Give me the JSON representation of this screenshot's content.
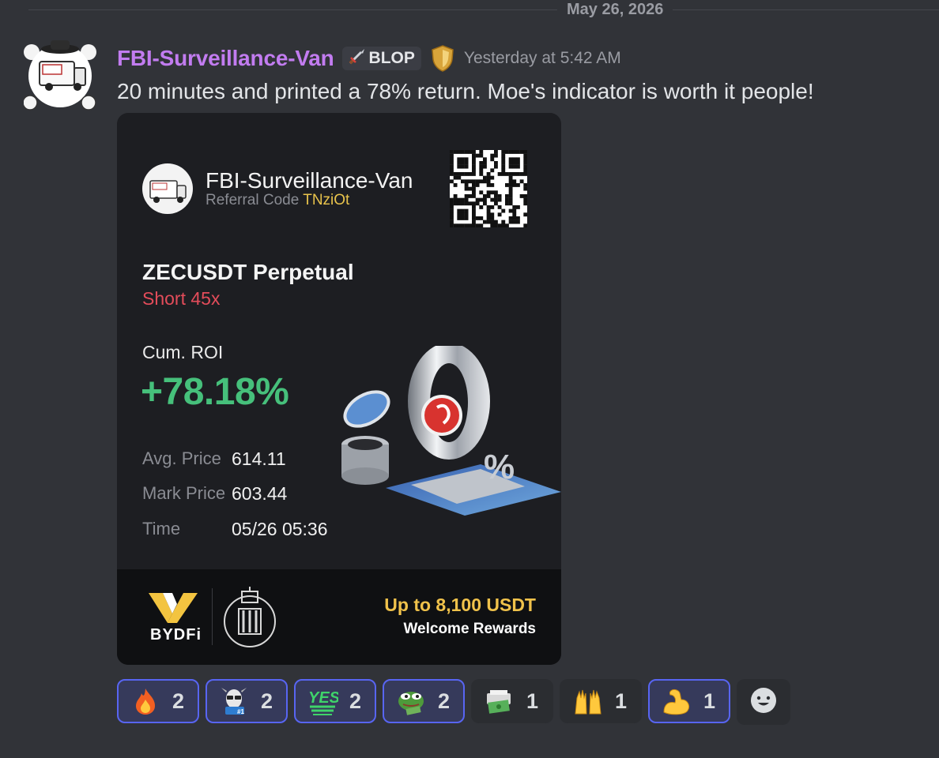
{
  "date_divider": "May 26, 2026",
  "author": {
    "name": "FBI-Surveillance-Van",
    "tag": "BLOP",
    "timestamp": "Yesterday at 5:42 AM"
  },
  "message_text": "20 minutes and printed a 78% return. Moe's indicator is worth it people!",
  "card": {
    "user_name": "FBI-Surveillance-Van",
    "referral_label": "Referral Code",
    "referral_code": "TNziOt",
    "pair": "ZECUSDT Perpetual",
    "side": "Short 45x",
    "roi_label": "Cum. ROI",
    "roi_value": "+78.18%",
    "stats": [
      {
        "label": "Avg. Price",
        "value": "614.11"
      },
      {
        "label": "Mark Price",
        "value": "603.44"
      },
      {
        "label": "Time",
        "value": "05/26 05:36"
      }
    ],
    "brand": "BYDFi",
    "reward_title": "Up to 8,100 USDT",
    "reward_sub": "Welcome Rewards"
  },
  "reactions": [
    {
      "icon": "fire-icon",
      "count": "2",
      "me": true
    },
    {
      "icon": "goat-icon",
      "count": "2",
      "me": true
    },
    {
      "icon": "yes-icon",
      "count": "2",
      "me": true
    },
    {
      "icon": "pepe-frog-icon",
      "count": "2",
      "me": true
    },
    {
      "icon": "money-printer-icon",
      "count": "1",
      "me": false
    },
    {
      "icon": "raised-hands-icon",
      "count": "1",
      "me": false
    },
    {
      "icon": "flexed-biceps-icon",
      "count": "1",
      "me": true
    }
  ],
  "colors": {
    "username": "#c27cf0",
    "roi_positive": "#46c07b",
    "short": "#e34c5a",
    "referral_code": "#e9c44c",
    "reaction_selected_border": "#5865f2"
  }
}
